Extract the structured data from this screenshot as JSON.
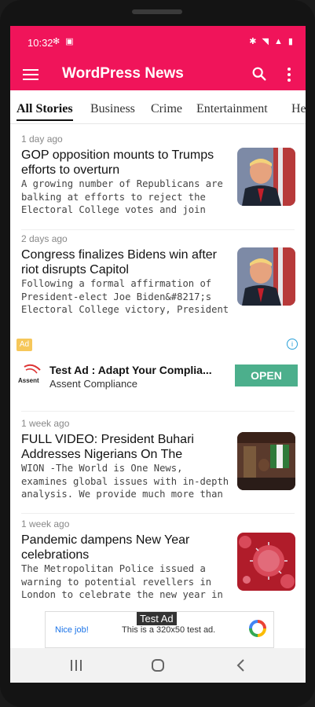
{
  "status_bar": {
    "time": "10:32",
    "left_icons": "✻ ▣",
    "right_icons": "✱ ◥ ▲ ▮"
  },
  "app_bar": {
    "title": "WordPress News"
  },
  "tabs": [
    {
      "label": "All Stories",
      "active": true
    },
    {
      "label": "Business",
      "active": false
    },
    {
      "label": "Crime",
      "active": false
    },
    {
      "label": "Entertainment",
      "active": false
    },
    {
      "label": "He",
      "active": false
    }
  ],
  "articles": [
    {
      "time": "1 day ago",
      "headline": "GOP opposition mounts to Trumps efforts to overturn",
      "summary": "A growing number of Republicans are balking at efforts to reject the Electoral College votes and join",
      "thumb": "trump-photo"
    },
    {
      "time": "2 days ago",
      "headline": "Congress finalizes Bidens win after riot disrupts Capitol",
      "summary": "Following a formal affirmation of President-elect Joe Biden&#8217;s Electoral College victory, President",
      "thumb": "trump-photo"
    },
    {
      "time": "1 week ago",
      "headline": "FULL VIDEO: President Buhari Addresses Nigerians On The",
      "summary": "WION -The World is One News, examines global issues with in-depth analysis. We provide much more than",
      "thumb": "office-photo"
    },
    {
      "time": "1 week ago",
      "headline": "Pandemic dampens New Year celebrations",
      "summary": "The Metropolitan Police issued a warning to potential revellers in London to celebrate the new year in",
      "thumb": "virus-photo"
    }
  ],
  "native_ad": {
    "badge": "Ad",
    "title": "Test Ad : Adapt Your Complia...",
    "advertiser": "Assent Compliance",
    "logo_text": "Assent",
    "cta": "OPEN"
  },
  "banner_ad": {
    "tag": "Test Ad",
    "nice_job": "Nice job!",
    "text": "This is a 320x50 test ad."
  },
  "colors": {
    "brand": "#f0145a",
    "open_button": "#4caf8c"
  }
}
